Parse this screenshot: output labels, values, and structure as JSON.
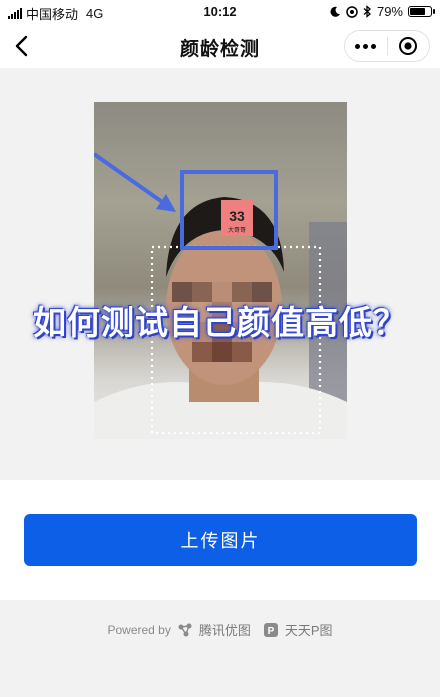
{
  "status_bar": {
    "carrier": "中国移动",
    "network": "4G",
    "time": "10:12",
    "battery": "79%",
    "battery_level": 0.79
  },
  "nav": {
    "title": "颜龄检测"
  },
  "photo": {
    "age_score": "33",
    "age_label": "大哥哥"
  },
  "overlay_title": "如何测试自己颜值高低？",
  "upload_button": "上传图片",
  "footer": {
    "powered_by": "Powered by",
    "brand1": "腾讯优图",
    "brand2": "天天P图"
  },
  "colors": {
    "primary": "#0c5fe6",
    "arrow": "#4a6ae0",
    "tag": "#f08080"
  }
}
